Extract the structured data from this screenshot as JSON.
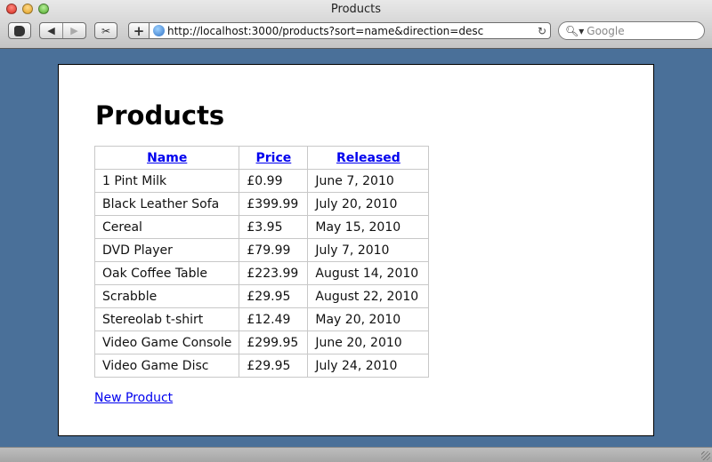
{
  "window": {
    "title": "Products"
  },
  "toolbar": {
    "back_icon": "◀",
    "forward_icon": "▶",
    "add_icon": "+",
    "clip_icon": "✂",
    "url": "http://localhost:3000/products?sort=name&direction=desc",
    "reload_icon": "↻",
    "search_icon": "🔍︎▾",
    "search_placeholder": "Google"
  },
  "page": {
    "heading": "Products",
    "table": {
      "headers": [
        "Name",
        "Price",
        "Released"
      ],
      "rows": [
        [
          "1 Pint Milk",
          "£0.99",
          "June 7, 2010"
        ],
        [
          "Black Leather Sofa",
          "£399.99",
          "July 20, 2010"
        ],
        [
          "Cereal",
          "£3.95",
          "May 15, 2010"
        ],
        [
          "DVD Player",
          "£79.99",
          "July 7, 2010"
        ],
        [
          "Oak Coffee Table",
          "£223.99",
          "August 14, 2010"
        ],
        [
          "Scrabble",
          "£29.95",
          "August 22, 2010"
        ],
        [
          "Stereolab t-shirt",
          "£12.49",
          "May 20, 2010"
        ],
        [
          "Video Game Console",
          "£299.95",
          "June 20, 2010"
        ],
        [
          "Video Game Disc",
          "£29.95",
          "July 24, 2010"
        ]
      ]
    },
    "new_product_link": "New Product"
  }
}
